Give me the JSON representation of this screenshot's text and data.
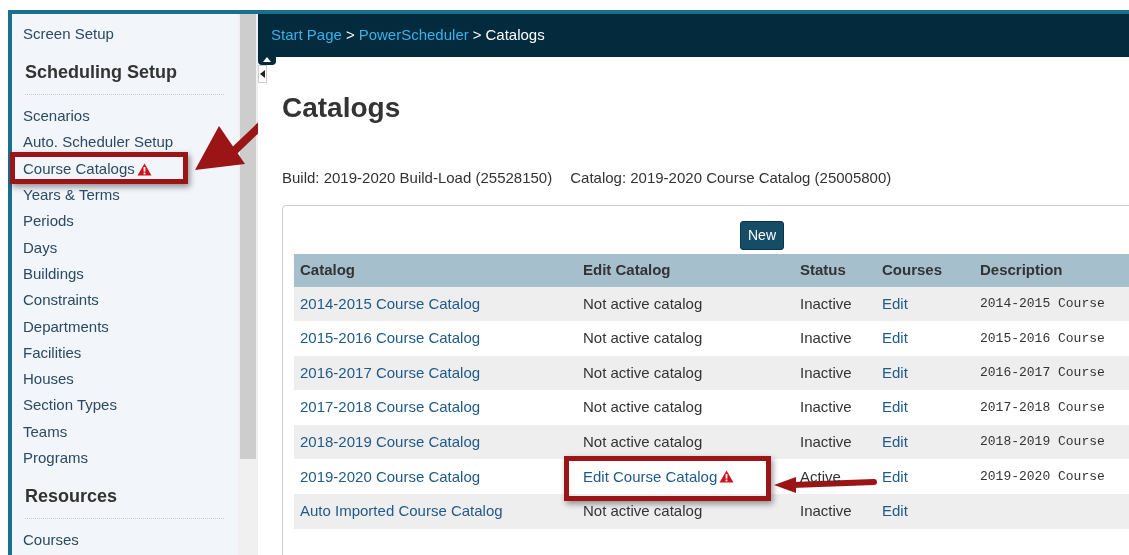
{
  "sidebar": {
    "sections": [
      {
        "items": [
          {
            "label": "Screen Setup",
            "highlighted": false,
            "warning": false
          }
        ]
      },
      {
        "heading": "Scheduling Setup",
        "items": [
          {
            "label": "Scenarios",
            "highlighted": false,
            "warning": false
          },
          {
            "label": "Auto. Scheduler Setup",
            "highlighted": false,
            "warning": false
          },
          {
            "label": "Course Catalogs",
            "highlighted": true,
            "warning": true
          },
          {
            "label": "Years & Terms",
            "highlighted": false,
            "warning": false
          },
          {
            "label": "Periods",
            "highlighted": false,
            "warning": false
          },
          {
            "label": "Days",
            "highlighted": false,
            "warning": false
          },
          {
            "label": "Buildings",
            "highlighted": false,
            "warning": false
          },
          {
            "label": "Constraints",
            "highlighted": false,
            "warning": false
          },
          {
            "label": "Departments",
            "highlighted": false,
            "warning": false
          },
          {
            "label": "Facilities",
            "highlighted": false,
            "warning": false
          },
          {
            "label": "Houses",
            "highlighted": false,
            "warning": false
          },
          {
            "label": "Section Types",
            "highlighted": false,
            "warning": false
          },
          {
            "label": "Teams",
            "highlighted": false,
            "warning": false
          },
          {
            "label": "Programs",
            "highlighted": false,
            "warning": false
          }
        ]
      },
      {
        "heading": "Resources",
        "items": [
          {
            "label": "Courses",
            "highlighted": false,
            "warning": false
          }
        ]
      }
    ]
  },
  "breadcrumb": {
    "links": [
      "Start Page",
      "PowerScheduler"
    ],
    "separator": ">",
    "current": "Catalogs"
  },
  "page_title": "Catalogs",
  "build_info": [
    {
      "text": "Build: 2019-2020 Build-Load (25528150)"
    },
    {
      "text": "Catalog: 2019-2020 Course Catalog (25005800)"
    }
  ],
  "new_button": "New",
  "table": {
    "columns": [
      "Catalog",
      "Edit Catalog",
      "Status",
      "Courses",
      "Description"
    ],
    "rows": [
      {
        "catalog": "2014-2015 Course Catalog",
        "edit": {
          "text": "Not active catalog",
          "kind": "text",
          "highlighted": false,
          "warning": false
        },
        "status": "Inactive",
        "courses": "Edit",
        "description": "2014-2015 Course"
      },
      {
        "catalog": "2015-2016 Course Catalog",
        "edit": {
          "text": "Not active catalog",
          "kind": "text",
          "highlighted": false,
          "warning": false
        },
        "status": "Inactive",
        "courses": "Edit",
        "description": "2015-2016 Course"
      },
      {
        "catalog": "2016-2017 Course Catalog",
        "edit": {
          "text": "Not active catalog",
          "kind": "text",
          "highlighted": false,
          "warning": false
        },
        "status": "Inactive",
        "courses": "Edit",
        "description": "2016-2017 Course"
      },
      {
        "catalog": "2017-2018 Course Catalog",
        "edit": {
          "text": "Not active catalog",
          "kind": "text",
          "highlighted": false,
          "warning": false
        },
        "status": "Inactive",
        "courses": "Edit",
        "description": "2017-2018 Course"
      },
      {
        "catalog": "2018-2019 Course Catalog",
        "edit": {
          "text": "Not active catalog",
          "kind": "text",
          "highlighted": false,
          "warning": false
        },
        "status": "Inactive",
        "courses": "Edit",
        "description": "2018-2019 Course"
      },
      {
        "catalog": "2019-2020 Course Catalog",
        "edit": {
          "text": "Edit Course Catalog",
          "kind": "link",
          "highlighted": true,
          "warning": true
        },
        "status": "Active",
        "courses": "Edit",
        "description": "2019-2020 Course"
      },
      {
        "catalog": "Auto Imported Course Catalog",
        "edit": {
          "text": "Not active catalog",
          "kind": "text",
          "highlighted": false,
          "warning": false
        },
        "status": "Inactive",
        "courses": "Edit",
        "description": null
      }
    ]
  }
}
